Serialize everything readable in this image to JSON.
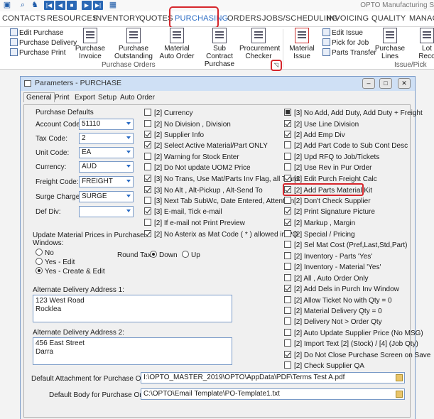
{
  "app_title": "OPTO Manufacturing S",
  "ribbon_tabs": [
    "CONTACTS",
    "RESOURCES",
    "INVENTORY",
    "QUOTES",
    "PURCHASING",
    "ORDERS",
    "JOBS/SCHEDULING",
    "INVOICING",
    "QUALITY",
    "MANAG"
  ],
  "ribbon": {
    "small_left": [
      "Edit Purchase",
      "Purchase Delivery",
      "Purchase Print"
    ],
    "big": [
      "Purchase Invoice",
      "Purchase Outstanding",
      "Material Auto Order",
      "Sub Contract Purchase",
      "Procurement Checker",
      "Material Issue"
    ],
    "big_lines": [
      [
        "Purchase",
        "Invoice"
      ],
      [
        "Purchase",
        "Outstanding"
      ],
      [
        "Material",
        "Auto Order"
      ],
      [
        "Sub Contract",
        "Purchase"
      ],
      [
        "Procurement",
        "Checker"
      ],
      [
        "Material",
        "Issue"
      ]
    ],
    "small_right": [
      "Edit Issue",
      "Pick for Job",
      "Parts Transfer"
    ],
    "big_right": [
      [
        "Purchase",
        "Lines"
      ],
      [
        "Lot",
        "Reco"
      ]
    ],
    "group_purchase_orders": "Purchase Orders",
    "group_issue_pick": "Issue/Pick"
  },
  "dialog": {
    "title": "Parameters - PURCHASE",
    "tabs": [
      "General",
      "Print",
      "Export",
      "Setup",
      "Auto Order"
    ],
    "defaults_heading": "Purchase Defaults",
    "fields": [
      {
        "label": "Account Code:",
        "value": "51110"
      },
      {
        "label": "Tax Code:",
        "value": "2"
      },
      {
        "label": "Unit Code:",
        "value": "EA"
      },
      {
        "label": "Currency:",
        "value": "AUD"
      },
      {
        "label": "Freight Code:",
        "value": "FREIGHT"
      },
      {
        "label": "Surge Charge:",
        "value": "SURGE"
      },
      {
        "label": "Def Div:",
        "value": ""
      }
    ],
    "update_prices_label": "Update Material Prices in Purchase Windows:",
    "update_prices_line1": "Update Material Prices in Purchase",
    "update_prices_line2": "Windows:",
    "update_options": [
      {
        "label": "No",
        "selected": false
      },
      {
        "label": "Yes - Edit",
        "selected": false
      },
      {
        "label": "Yes - Create & Edit",
        "selected": true
      }
    ],
    "round_tax_label": "Round Tax:",
    "round_tax_options": [
      {
        "label": "Down",
        "selected": true
      },
      {
        "label": "Up",
        "selected": false
      }
    ],
    "alt_address_1_label": "Alternate Delivery Address 1:",
    "alt_address_1": [
      "123 West Road",
      "Rocklea"
    ],
    "alt_address_2_label": "Alternate Delivery Address 2:",
    "alt_address_2": [
      "456 East Street",
      "Darra"
    ],
    "attachment_label": "Default Attachment for Purchase Order:",
    "attachment_value": "I:\\OPTO_MASTER_2019\\OPTO\\AppData\\PDF\\Terms Test A.pdf",
    "body_label": "Default Body for Purchase Order:",
    "body_value": "C:\\OPTO\\Email Template\\PO-Template1.txt",
    "middle_checks": [
      {
        "label": "[2] Currency",
        "checked": false
      },
      {
        "label": "[2] No Division , Division",
        "checked": false
      },
      {
        "label": "[2] Supplier Info",
        "checked": true
      },
      {
        "label": "[2] Select Active Material/Part ONLY",
        "checked": true
      },
      {
        "label": "[2] Warning for Stock Enter",
        "checked": false
      },
      {
        "label": "[2] Do Not update UOM2 Price",
        "checked": false
      },
      {
        "label": "[3] No Trans, Use Mat/Parts Inv Flag, all Trans",
        "checked": true
      },
      {
        "label": "[3] No Alt , Alt-Pickup , Alt-Send To",
        "checked": true
      },
      {
        "label": "[3] Next Tab SubWc, Date Entered, Attention",
        "checked": false
      },
      {
        "label": "[3] E-mail, Tick e-mail",
        "checked": true
      },
      {
        "label": "[2] If e-mail not Print Preview",
        "checked": false
      },
      {
        "label": "[2] No Asterix as Mat Code ( * ) allowed in PO",
        "checked": true
      }
    ],
    "right_checks": [
      {
        "label": "[3] No Add, Add Duty, Add Duty + Freight",
        "checked": "fill"
      },
      {
        "label": "[2] Use Line Division",
        "checked": true
      },
      {
        "label": "[2] Add Emp Div",
        "checked": true
      },
      {
        "label": "[2] Add Part Code to Sub Cont Desc",
        "checked": false
      },
      {
        "label": "[2] Upd RFQ to Job/Tickets",
        "checked": false
      },
      {
        "label": "[2] Use Rev in Pur Order",
        "checked": false
      },
      {
        "label": "[2] Edit Purch Freight Calc",
        "checked": true
      },
      {
        "label": "[2] Add Parts Material Kit",
        "checked": true
      },
      {
        "label": "[2] Don't Check Supplier",
        "checked": false
      },
      {
        "label": "[2] Print Signature Picture",
        "checked": true
      },
      {
        "label": "[2] Markup , Margin",
        "checked": true
      },
      {
        "label": "[2] Special / Pricing",
        "checked": false
      },
      {
        "label": "[2] Sel Mat Cost (Pref,Last,Std,Part)",
        "checked": false
      },
      {
        "label": "[2] Inventory - Parts 'Yes'",
        "checked": false
      },
      {
        "label": "[2] Inventory - Material 'Yes'",
        "checked": false
      },
      {
        "label": "[2] All , Auto Order Only",
        "checked": false
      },
      {
        "label": "[2] Add Dels in Purch Inv Window",
        "checked": true
      },
      {
        "label": "[2] Allow Ticket No with Qty = 0",
        "checked": false
      },
      {
        "label": "[2] Material Delivery  Qty = 0",
        "checked": false
      },
      {
        "label": "[2] Delivery Not > Order Qty",
        "checked": false
      },
      {
        "label": "[2] Auto Update Supplier Price (No MSG)",
        "checked": false
      },
      {
        "label": "[2] Import Text [2] (Stock) / [4] (Job Qty)",
        "checked": false
      },
      {
        "label": "[2] Do Not Close Purchase Screen on Save",
        "checked": true
      },
      {
        "label": "[2] Check Supplier QA",
        "checked": false
      }
    ]
  }
}
